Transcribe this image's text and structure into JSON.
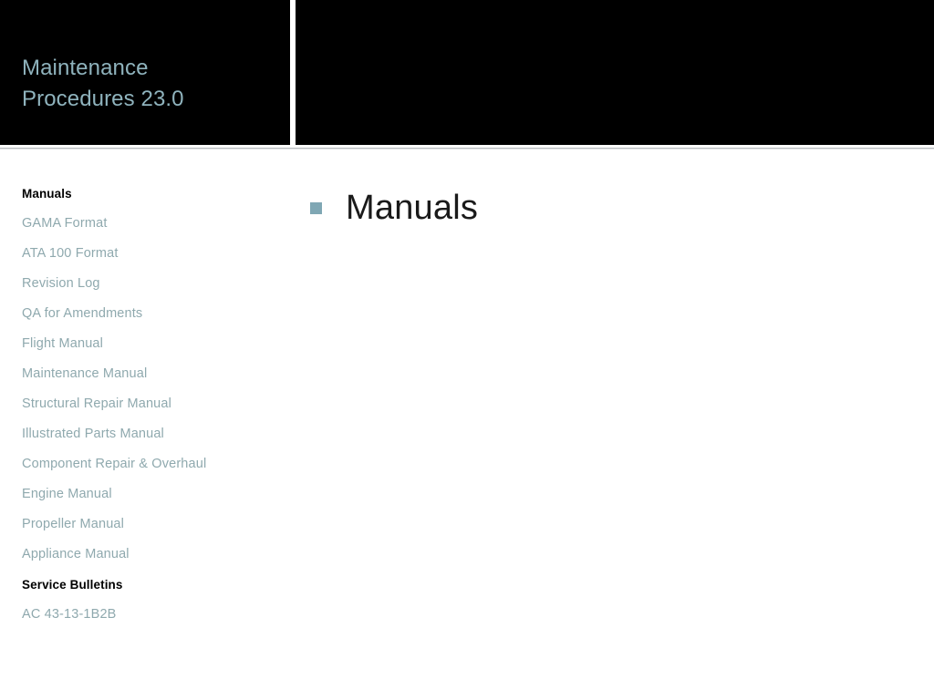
{
  "slide": {
    "title": "Maintenance\nProcedures 23.0",
    "title_color": "#8fb3bd",
    "banner_color": "#000000",
    "background_color": "#ffffff"
  },
  "sidebar": {
    "items": [
      {
        "label": "Manuals",
        "style": "heading"
      },
      {
        "label": "GAMA Format",
        "style": "link"
      },
      {
        "label": "ATA 100 Format",
        "style": "link"
      },
      {
        "label": "Revision Log",
        "style": "link"
      },
      {
        "label": "QA for Amendments",
        "style": "link"
      },
      {
        "label": "Flight Manual",
        "style": "link"
      },
      {
        "label": "Maintenance Manual",
        "style": "link"
      },
      {
        "label": "Structural Repair Manual",
        "style": "link"
      },
      {
        "label": "Illustrated Parts Manual",
        "style": "link"
      },
      {
        "label": "Component Repair & Overhaul",
        "style": "link"
      },
      {
        "label": "Engine Manual",
        "style": "link"
      },
      {
        "label": "Propeller Manual",
        "style": "link"
      },
      {
        "label": "Appliance Manual",
        "style": "link"
      },
      {
        "label": "Service Bulletins",
        "style": "heading"
      },
      {
        "label": "AC 43-13-1B2B",
        "style": "link"
      }
    ],
    "link_color": "#8fa9ae",
    "heading_color": "#000000"
  },
  "main": {
    "bullets": [
      {
        "text": "Manuals",
        "marker": "square-bullet-icon"
      }
    ],
    "bullet_color": "#7fa7b4",
    "text_color": "#1a1a1a"
  }
}
